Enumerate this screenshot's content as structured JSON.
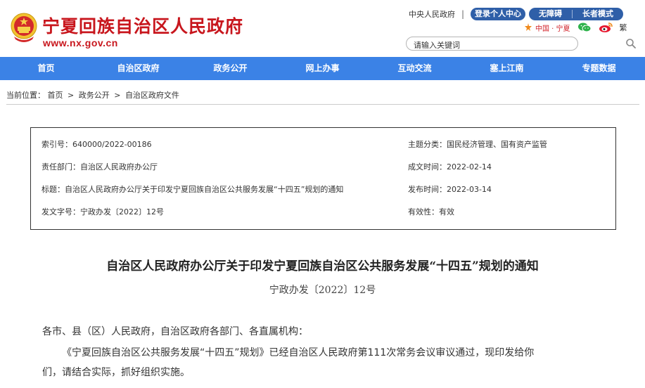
{
  "site": {
    "title": "宁夏回族自治区人民政府",
    "url": "www.nx.gov.cn",
    "emblem_icon": "national-emblem-icon"
  },
  "top_links": {
    "central_gov": "中央人民政府",
    "separator": "|",
    "login": "登录个人中心",
    "accessibility": "无障碍",
    "elder_mode": "长者模式"
  },
  "social": {
    "china_ningxia": "中国 · 宁夏",
    "wechat_icon": "wechat-icon",
    "weibo_icon": "weibo-icon",
    "traditional": "繁"
  },
  "search": {
    "placeholder": "请输入关键词",
    "icon": "search-icon"
  },
  "nav": {
    "items": [
      "首页",
      "自治区政府",
      "政务公开",
      "网上办事",
      "互动交流",
      "塞上江南",
      "专题数据"
    ],
    "color": "#3b82e6"
  },
  "breadcrumb": {
    "label": "当前位置：",
    "items": [
      "首页",
      "政务公开",
      "自治区政府文件"
    ],
    "sep": ">"
  },
  "meta": {
    "index_no": "索引号：640000/2022-00186",
    "topic": "主题分类：国民经济管理、国有资产监管",
    "dept": "责任部门：自治区人民政府办公厅",
    "date_written": "成文时间：2022-02-14",
    "subject": "标题：自治区人民政府办公厅关于印发宁夏回族自治区公共服务发展“十四五”规划的通知",
    "date_published": "发布时间：2022-03-14",
    "doc_no": "发文字号：宁政办发〔2022〕12号",
    "validity": "有效性：有效"
  },
  "doc": {
    "title": "自治区人民政府办公厅关于印发宁夏回族自治区公共服务发展“十四五”规划的通知",
    "number": "宁政办发〔2022〕12号",
    "salutation": "各市、县（区）人民政府，自治区政府各部门、各直属机构：",
    "body_line1": "《宁夏回族自治区公共服务发展“十四五”规划》已经自治区人民政府第111次常务会议审议通过，现印发给你",
    "body_line2": "们，请结合实际，抓好组织实施。"
  },
  "colors": {
    "brand_red": "#c8161d",
    "button_blue": "#2f5fa8"
  }
}
